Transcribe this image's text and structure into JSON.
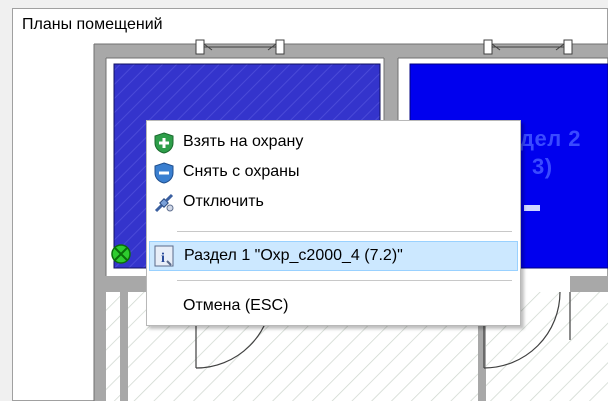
{
  "window": {
    "title": "Планы помещений"
  },
  "rooms": [
    {
      "label": "",
      "partial_label": "дел 2",
      "sub_label": "3)",
      "color": "#0000ee"
    }
  ],
  "colors": {
    "room_left": "#3a3ad0",
    "room_right": "#0000ee",
    "wall": "#a8a8a8",
    "menu_highlight": "#cce8ff"
  },
  "context_menu": {
    "items": [
      {
        "label": "Взять на охрану",
        "icon": "shield-plus-icon"
      },
      {
        "label": "Снять с охраны",
        "icon": "shield-minus-icon"
      },
      {
        "label": "Отключить",
        "icon": "disconnect-icon"
      },
      {
        "label": "Раздел 1  \"Охр_c2000_4 (7.2)\"",
        "icon": "info-icon",
        "selected": true
      },
      {
        "label": "Отмена (ESC)",
        "icon": ""
      }
    ]
  }
}
